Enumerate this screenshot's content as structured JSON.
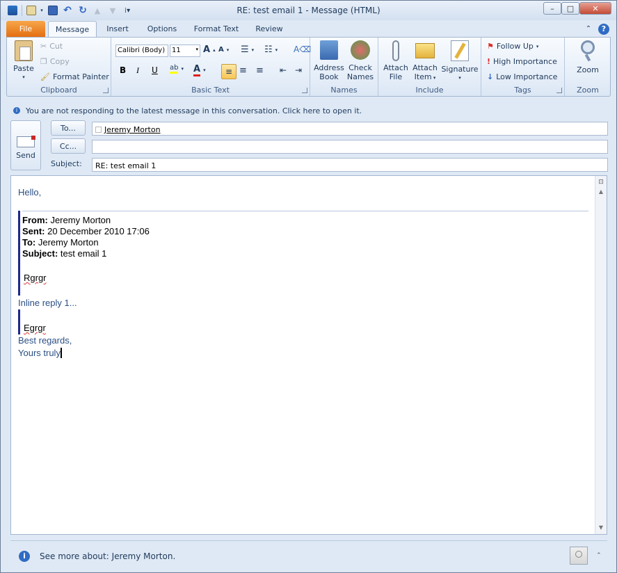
{
  "window": {
    "title": "RE: test email 1  -  Message (HTML)",
    "controls": [
      "–",
      "□",
      "✕"
    ]
  },
  "tabs": [
    "File",
    "Message",
    "Insert",
    "Options",
    "Format Text",
    "Review"
  ],
  "ribbon": {
    "clipboard": {
      "paste": "Paste",
      "cut": "Cut",
      "copy": "Copy",
      "format_painter": "Format Painter",
      "label": "Clipboard"
    },
    "basic_text": {
      "font": "Calibri (Body)",
      "size": "11",
      "label": "Basic Text",
      "bold": "B",
      "italic": "I",
      "underline": "U"
    },
    "names": {
      "address_book_1": "Address",
      "address_book_2": "Book",
      "check_names_1": "Check",
      "check_names_2": "Names",
      "label": "Names"
    },
    "include": {
      "attach_file_1": "Attach",
      "attach_file_2": "File",
      "attach_item_1": "Attach",
      "attach_item_2": "Item",
      "signature": "Signature",
      "label": "Include"
    },
    "tags": {
      "follow_up": "Follow Up",
      "high": "High Importance",
      "low": "Low Importance",
      "label": "Tags"
    },
    "zoom": {
      "zoom": "Zoom",
      "label": "Zoom"
    }
  },
  "infobar": {
    "text": "You are not responding to the latest message in this conversation. Click here to open it."
  },
  "header": {
    "send": "Send",
    "to_button": "To...",
    "cc_button": "Cc...",
    "subject_label": "Subject:",
    "to_value": "Jeremy Morton",
    "cc_value": "",
    "subject_value": "RE: test email 1"
  },
  "body": {
    "greeting": "Hello,",
    "from_label": "From:",
    "from_value": " Jeremy Morton",
    "sent_label": "Sent:",
    "sent_value": " 20 December 2010 17:06",
    "to_label": "To:",
    "to_value": " Jeremy Morton",
    "subject_label": "Subject:",
    "subject_value": " test email 1",
    "quoted1": "Rgrgr",
    "inline_reply": "Inline reply 1...",
    "quoted2": "Egrgr",
    "closing1": "Best regards,",
    "closing2": "Yours truly"
  },
  "status": {
    "text": "See more about: Jeremy Morton."
  }
}
